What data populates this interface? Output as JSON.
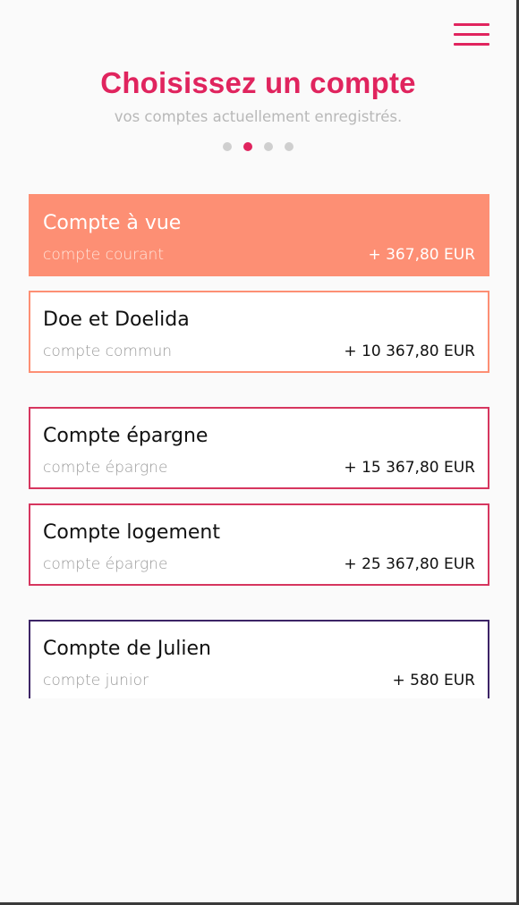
{
  "header": {
    "title": "Choisissez un compte",
    "subtitle": "vos comptes actuellement enregistrés.",
    "pagination": {
      "total": 4,
      "active_index": 1
    }
  },
  "colors": {
    "accent": "#e0245e",
    "selected_fill": "#fd8f74",
    "group_current_border": "#fd8f74",
    "group_savings_border": "#d6365f",
    "group_junior_border": "#3c2466"
  },
  "accounts": [
    {
      "name": "Compte à vue",
      "type": "compte courant",
      "amount": "+ 367,80 EUR",
      "selected": true
    },
    {
      "name": "Doe et Doelida",
      "type": "compte commun",
      "amount": "+ 10 367,80 EUR",
      "selected": false
    },
    {
      "name": "Compte épargne",
      "type": "compte épargne",
      "amount": "+ 15 367,80 EUR",
      "selected": false
    },
    {
      "name": "Compte logement",
      "type": "compte épargne",
      "amount": "+ 25 367,80 EUR",
      "selected": false
    },
    {
      "name": "Compte de Julien",
      "type": "compte junior",
      "amount": "+ 580 EUR",
      "selected": false
    }
  ]
}
